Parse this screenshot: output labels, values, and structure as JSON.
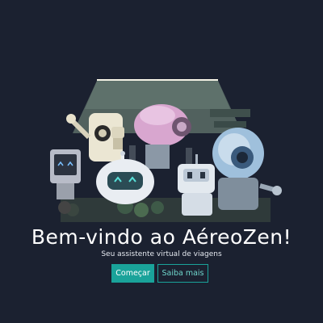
{
  "hero": {
    "title": "Bem-vindo ao AéreoZen!",
    "subtitle": "Seu assistente virtual de viagens"
  },
  "actions": {
    "primary_label": "Começar",
    "secondary_label": "Saiba mais"
  },
  "colors": {
    "background": "#1b2130",
    "accent": "#1aa39a",
    "secondary_text": "#6fd6cc"
  },
  "illustration": "robots-group-illustration"
}
